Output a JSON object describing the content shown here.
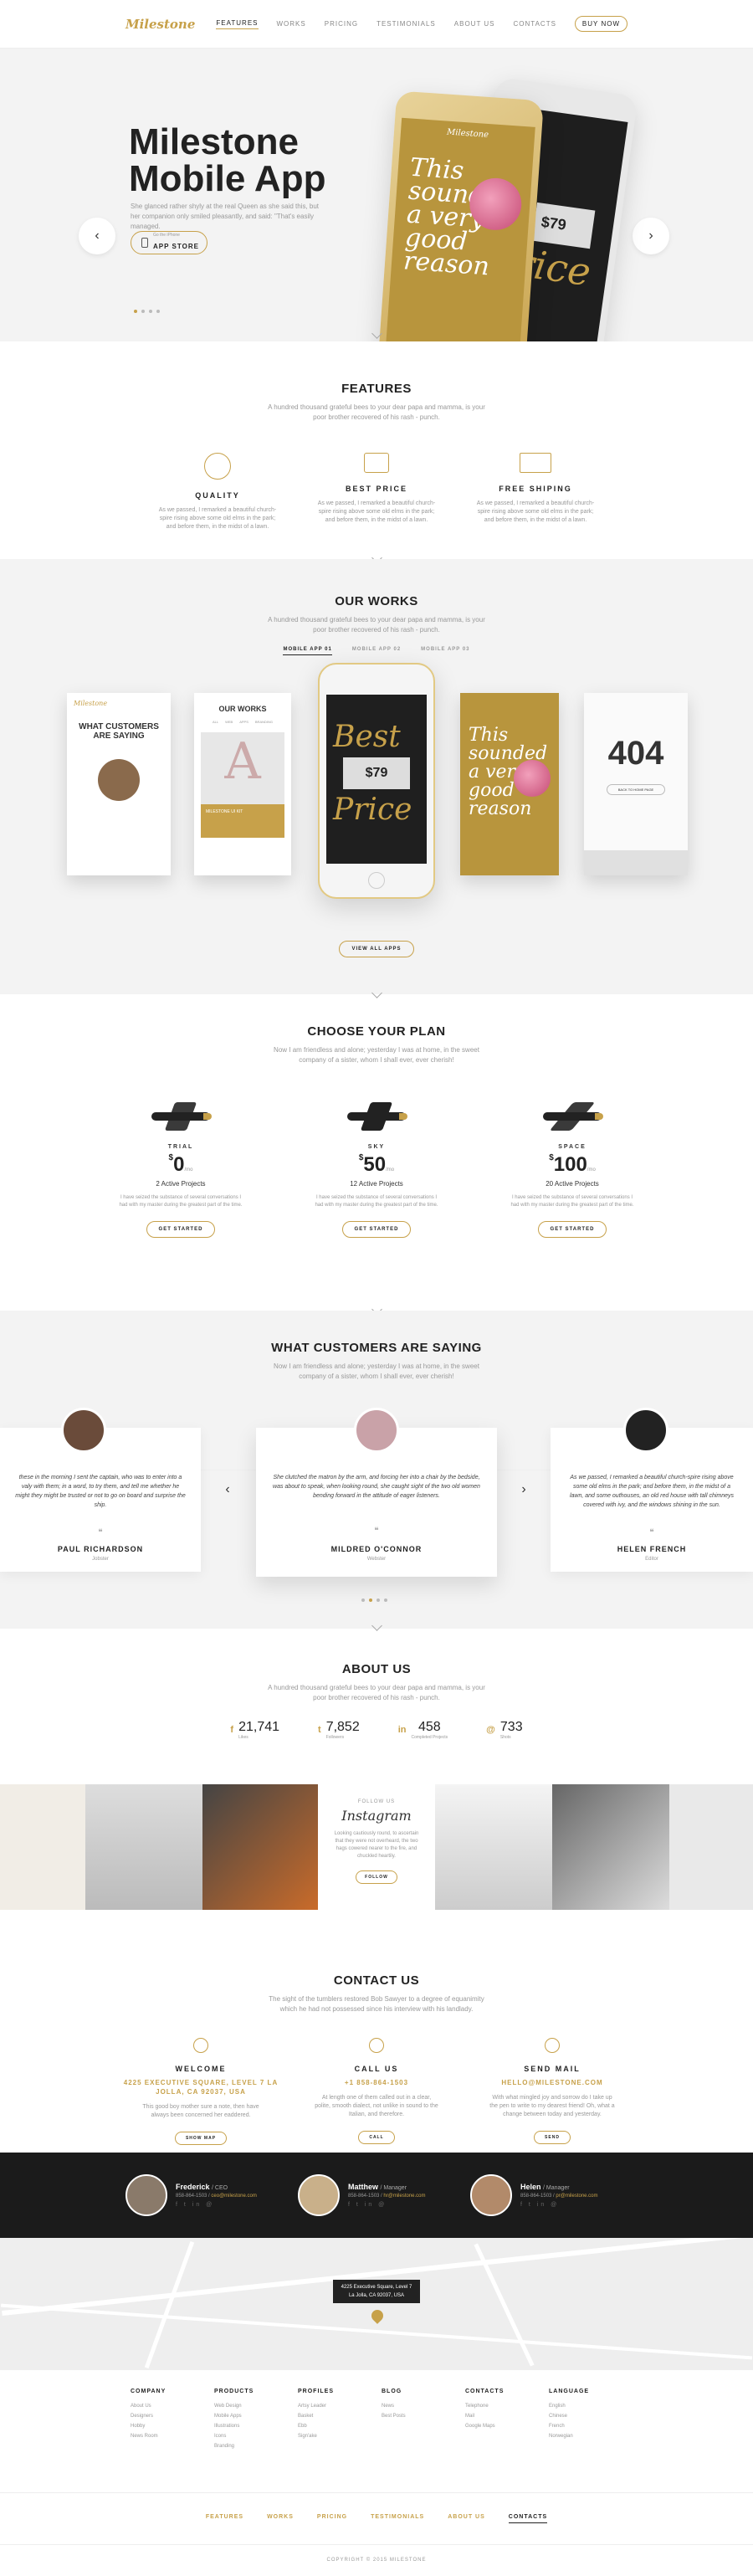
{
  "header": {
    "logo": "Milestone",
    "nav": [
      "FEATURES",
      "WORKS",
      "PRICING",
      "TESTIMONIALS",
      "ABOUT US",
      "CONTACTS"
    ],
    "buy": "BUY NOW"
  },
  "hero": {
    "title_line1": "Milestone",
    "title_line2": "Mobile App",
    "text": "She glanced rather shyly at the real Queen as she said this, but her companion only smiled pleasantly, and said: \"That's easily managed.",
    "app_btn_small": "Go the iPhone",
    "app_btn": "APP STORE",
    "screen_text": "This sounded a very good reason",
    "screen_price": "$79",
    "screen_word": "Price"
  },
  "features": {
    "title": "FEATURES",
    "subtitle": "A hundred thousand grateful bees to your dear papa and mamma, is your poor brother recovered of his rash - punch.",
    "items": [
      {
        "title": "QUALITY",
        "text": "As we passed, I remarked a beautiful church-spire rising above some old elms in the park; and before them, in the midst of a lawn."
      },
      {
        "title": "BEST PRICE",
        "text": "As we passed, I remarked a beautiful church-spire rising above some old elms in the park; and before them, in the midst of a lawn."
      },
      {
        "title": "FREE SHIPING",
        "text": "As we passed, I remarked a beautiful church-spire rising above some old elms in the park; and before them, in the midst of a lawn."
      }
    ]
  },
  "works": {
    "title": "OUR WORKS",
    "subtitle": "A hundred thousand grateful bees to your dear papa and mamma, is your poor brother recovered of his rash - punch.",
    "tabs": [
      "MOBILE APP 01",
      "MOBILE APP 02",
      "MOBILE APP 03"
    ],
    "card1_title": "WHAT CUSTOMERS ARE SAYING",
    "card2_title": "OUR WORKS",
    "card2_tabs": [
      "ALL",
      "WEB",
      "APPS",
      "BRANDING"
    ],
    "card2_item": "MILESTONE UI KIT",
    "phone_word1": "Best",
    "phone_price": "$79",
    "phone_word2": "Price",
    "card4_text": "This sounded a very good reason",
    "card5_text": "404",
    "card5_btn": "BACK TO HOME PAGE",
    "view_all": "VIEW ALL APPS"
  },
  "pricing": {
    "title": "CHOOSE YOUR PLAN",
    "subtitle": "Now I am friendless and alone; yesterday I was at home, in the sweet company of a sister, whom I shall ever, ever cherish!",
    "plans": [
      {
        "name": "TRIAL",
        "price": "0",
        "per": "/mo",
        "projects": "2 Active Projects",
        "text": "I have seized the substance of several conversations I had with my master during the greatest part of the time.",
        "btn": "GET STARTED"
      },
      {
        "name": "SKY",
        "price": "50",
        "per": "/mo",
        "projects": "12 Active Projects",
        "text": "I have seized the substance of several conversations I had with my master during the greatest part of the time.",
        "btn": "GET STARTED"
      },
      {
        "name": "SPACE",
        "price": "100",
        "per": "/mo",
        "projects": "20 Active Projects",
        "text": "I have seized the substance of several conversations I had with my master during the greatest part of the time.",
        "btn": "GET STARTED"
      }
    ],
    "currency": "$"
  },
  "testimonials": {
    "title": "WHAT CUSTOMERS ARE SAYING",
    "subtitle": "Now I am friendless and alone; yesterday I was at home, in the sweet company of a sister, whom I shall ever, ever cherish!",
    "items": [
      {
        "quote": "these in the morning I sent the captain, who was to enter into a valy with them; in a word, to try them, and tell me whether he might they might be trusted or not to go on board and surprise the ship.",
        "name": "PAUL RICHARDSON",
        "role": "Jobster"
      },
      {
        "quote": "She clutched the matron by the arm, and forcing her into a chair by the bedside, was about to speak, when looking round, she caught sight of the two old women bending forward in the attitude of eager listeners.",
        "name": "MILDRED O'CONNOR",
        "role": "Webster"
      },
      {
        "quote": "As we passed, I remarked a beautiful church-spire rising above some old elms in the park; and before them, in the midst of a lawn, and some outhouses, an old red house with tall chimneys covered with ivy, and the windows shining in the sun.",
        "name": "HELEN FRENCH",
        "role": "Editor"
      }
    ]
  },
  "about": {
    "title": "ABOUT US",
    "subtitle": "A hundred thousand grateful bees to your dear papa and mamma, is your poor brother recovered of his rash - punch.",
    "stats": [
      {
        "icon": "f",
        "value": "21,741",
        "label": "Likes"
      },
      {
        "icon": "t",
        "value": "7,852",
        "label": "Followers"
      },
      {
        "icon": "in",
        "value": "458",
        "label": "Completed Projects"
      },
      {
        "icon": "@",
        "value": "733",
        "label": "Shots"
      }
    ],
    "instagram_follow": "FOLLOW US",
    "instagram_name": "Instagram",
    "instagram_text": "Looking cautiously round, to ascertain that they were not overheard, the two hags cowered nearer to the fire, and chuckled heartily.",
    "instagram_btn": "FOLLOW"
  },
  "contact": {
    "title": "CONTACT US",
    "subtitle": "The sight of the tumblers restored Bob Sawyer to a degree of equanimity which he had not possessed since his interview with his landlady.",
    "cols": [
      {
        "title": "WELCOME",
        "gold": "4225 EXECUTIVE SQUARE, LEVEL 7 LA JOLLA, CA 92037, USA",
        "text": "This good boy mother sure a note, then have always been concerned her eaddered.",
        "btn": "SHOW MAP"
      },
      {
        "title": "CALL US",
        "gold": "+1 858-864-1503",
        "text": "At length one of them called out in a clear, polite, smooth dialect, not unlike in sound to the Italian, and therefore.",
        "btn": "CALL"
      },
      {
        "title": "SEND MAIL",
        "gold": "HELLO@MILESTONE.COM",
        "text": "With what mingled joy and sorrow do I take up the pen to write to my dearest friend! Oh, what a change between today and yesterday.",
        "btn": "SEND"
      }
    ]
  },
  "team": [
    {
      "name": "Frederick",
      "role": "/ CEO",
      "phone": "858-864-1503",
      "email": "ceo@milestone.com"
    },
    {
      "name": "Matthew",
      "role": "/ Manager",
      "phone": "858-864-1503",
      "email": "hr@milestone.com"
    },
    {
      "name": "Helen",
      "role": "/ Manager",
      "phone": "858-864-1503",
      "email": "pr@milestone.com"
    }
  ],
  "map": {
    "address_line1": "4225 Executive Square, Level 7",
    "address_line2": "La Jolla, CA 92037, USA"
  },
  "footer": {
    "cols": [
      {
        "title": "COMPANY",
        "items": [
          "About Us",
          "Designers",
          "Hobby",
          "News Room"
        ]
      },
      {
        "title": "PRODUCTS",
        "items": [
          "Web Design",
          "Mobile Apps",
          "Illustrations",
          "Icons",
          "Branding"
        ]
      },
      {
        "title": "PROFILES",
        "items": [
          "Artsy Leader",
          "Basket",
          "Ebb",
          "Sign'ake"
        ]
      },
      {
        "title": "BLOG",
        "items": [
          "News",
          "Best Posts"
        ]
      },
      {
        "title": "CONTACTS",
        "items": [
          "Telephone",
          "Mail",
          "Google Maps"
        ]
      },
      {
        "title": "LANGUAGE",
        "items": [
          "English",
          "Chinese",
          "French",
          "Norwegian"
        ]
      }
    ],
    "nav": [
      "FEATURES",
      "WORKS",
      "PRICING",
      "TESTIMONIALS",
      "ABOUT US",
      "CONTACTS"
    ],
    "copyright": "COPYRIGHT © 2015 MILESTONE"
  }
}
